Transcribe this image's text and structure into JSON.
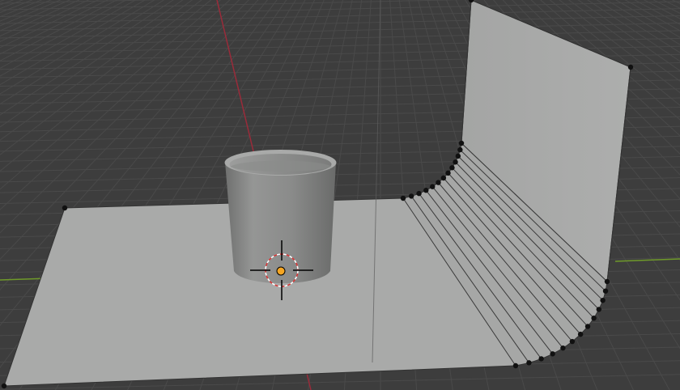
{
  "viewport": {
    "background_color": "#3d3d3d",
    "grid_color": "#4a4a4a",
    "x_axis_color": "#9a2b3a",
    "y_axis_color": "#6f9a2a",
    "backdrop_color": "#a9aaa9",
    "backdrop_shade_color": "#9c9d9c",
    "cup_color": "#8d8e8d",
    "edge_color": "#333333",
    "selected_vertex_color": "#111111",
    "origin_color": "#f5a623"
  },
  "objects": [
    {
      "name": "backdrop-plane",
      "type": "mesh",
      "selected_vertices": true
    },
    {
      "name": "cup",
      "type": "mesh"
    }
  ],
  "cursor": {
    "icon": "3d-cursor-icon"
  },
  "origin": {
    "icon": "object-origin-dot"
  }
}
